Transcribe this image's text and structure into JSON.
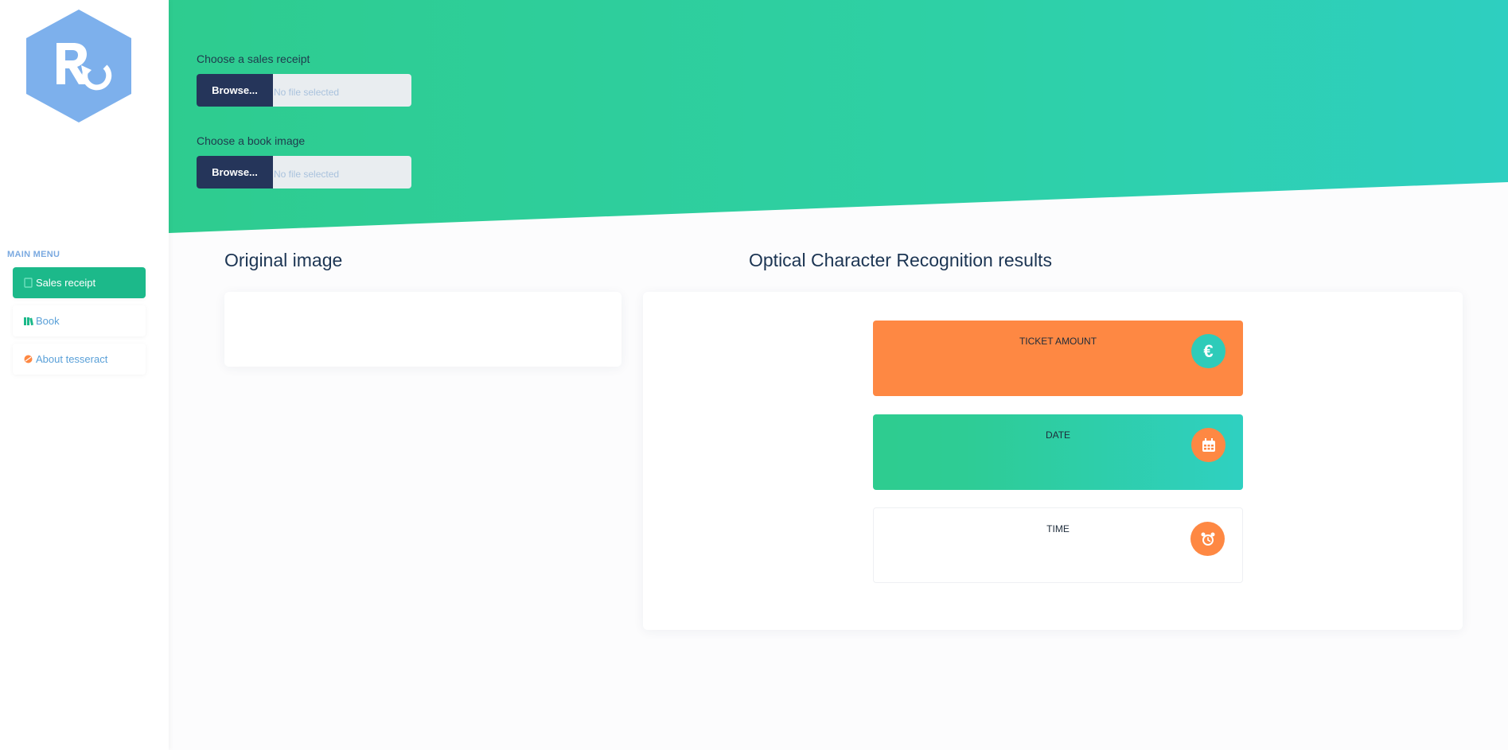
{
  "sidebar": {
    "logo_alt": "R",
    "menu_title": "MAIN MENU",
    "items": [
      {
        "label": "Sales receipt",
        "icon": "receipt-icon",
        "active": true
      },
      {
        "label": "Book",
        "icon": "books-icon",
        "active": false
      },
      {
        "label": "About tesseract",
        "icon": "satellite-icon",
        "active": false
      }
    ]
  },
  "uploads": {
    "receipt": {
      "label": "Choose a sales receipt",
      "button": "Browse...",
      "placeholder": "No file selected"
    },
    "book": {
      "label": "Choose a book image",
      "button": "Browse...",
      "placeholder": "No file selected"
    }
  },
  "main": {
    "original_title": "Original image",
    "ocr_title": "Optical Character Recognition results",
    "cards": [
      {
        "label": "TICKET AMOUNT",
        "icon": "euro-icon",
        "symbol": "€"
      },
      {
        "label": "DATE",
        "icon": "calendar-icon",
        "symbol": ""
      },
      {
        "label": "TIME",
        "icon": "alarm-clock-icon",
        "symbol": ""
      }
    ]
  },
  "colors": {
    "accent_green": "#2ecc8f",
    "accent_teal": "#2ecfc0",
    "accent_orange": "#fe8843",
    "navy": "#25355a",
    "logo_blue": "#7db0ec"
  }
}
